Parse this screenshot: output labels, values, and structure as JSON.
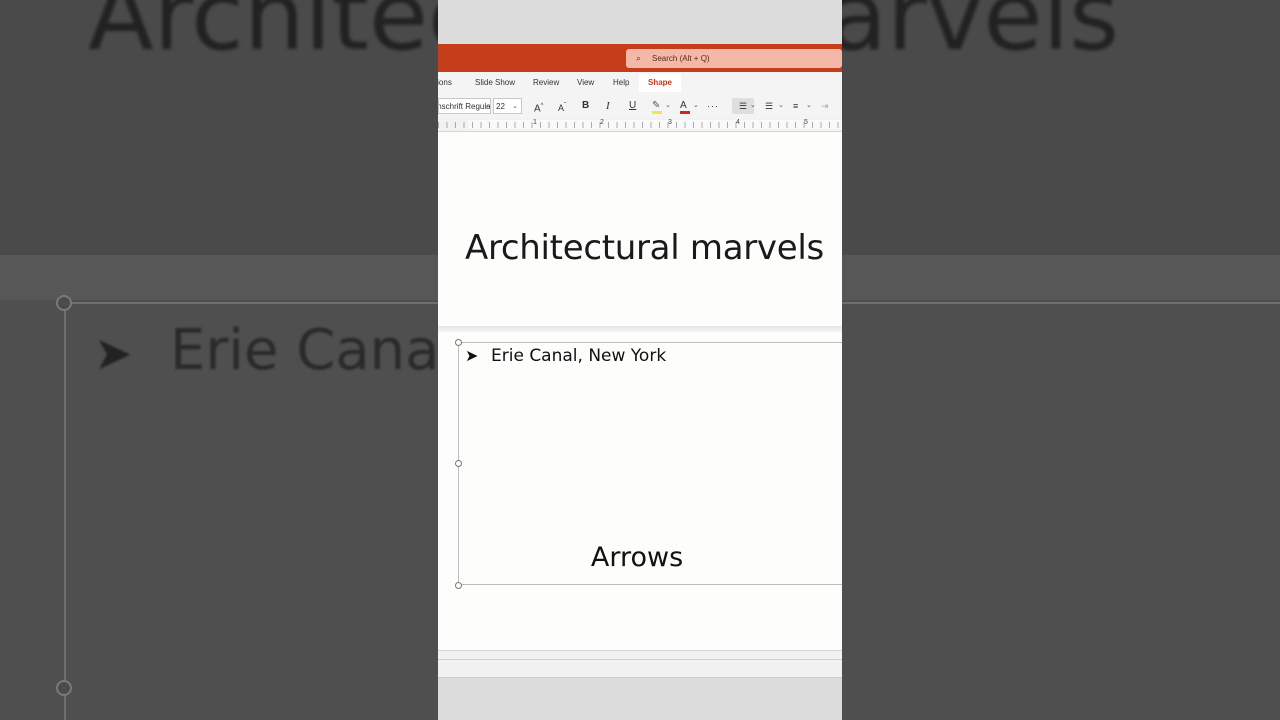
{
  "background": {
    "title_text": "Architectural marvels",
    "body_text": "Erie Canal"
  },
  "app": {
    "search": {
      "placeholder": "Search (Alt + Q)"
    },
    "tabs": [
      {
        "label": "Transitions"
      },
      {
        "label": "Slide Show"
      },
      {
        "label": "Review"
      },
      {
        "label": "View"
      },
      {
        "label": "Help"
      },
      {
        "label": "Shape"
      }
    ],
    "active_tab": "Shape",
    "ribbon": {
      "font_name": "Bahnschrift Regular",
      "font_size": "22",
      "grow_font": "A",
      "shrink_font": "A",
      "bold": "B",
      "italic": "I",
      "underline": "U",
      "font_color": "A",
      "more": "···"
    },
    "ruler_numbers": [
      "1",
      "2",
      "3",
      "4",
      "5"
    ],
    "colors": {
      "accent": "#c43e1c",
      "search_bg": "#f3b8a8"
    }
  },
  "slide": {
    "title": "Architectural marvels",
    "bullet_icon": "arrowhead-bullet-icon",
    "bullet_text": "Erie Canal, New York"
  },
  "caption": "Arrows"
}
